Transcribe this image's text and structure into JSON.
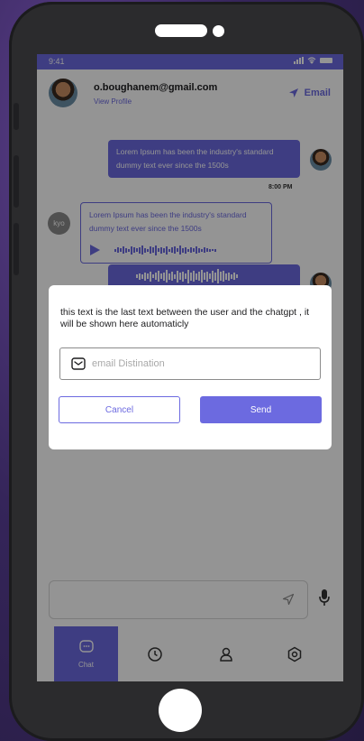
{
  "status_bar": {
    "time": "9:41"
  },
  "header": {
    "email": "o.boughanem@gmail.com",
    "view_profile": "View Profile",
    "email_action": "Email"
  },
  "messages": [
    {
      "type": "outgoing",
      "text": "Lorem Ipsum has been the industry's standard dummy text ever since the 1500s",
      "time": "8:00 PM"
    },
    {
      "type": "incoming",
      "sender_initials": "kyo",
      "text": "Lorem Ipsum has been the industry's standard dummy text ever since the 1500s"
    }
  ],
  "composer": {
    "placeholder": ""
  },
  "nav": [
    {
      "label": "Chat",
      "icon": "chat-icon",
      "active": true
    },
    {
      "label": "",
      "icon": "clock-icon"
    },
    {
      "label": "",
      "icon": "user-icon"
    },
    {
      "label": "",
      "icon": "settings-icon"
    }
  ],
  "modal": {
    "message": "this text is the last text between the user and the chatgpt , it will be shown here automaticly",
    "email_placeholder": "email Distination",
    "cancel_label": "Cancel",
    "send_label": "Send"
  },
  "colors": {
    "accent": "#6c6ae0"
  }
}
